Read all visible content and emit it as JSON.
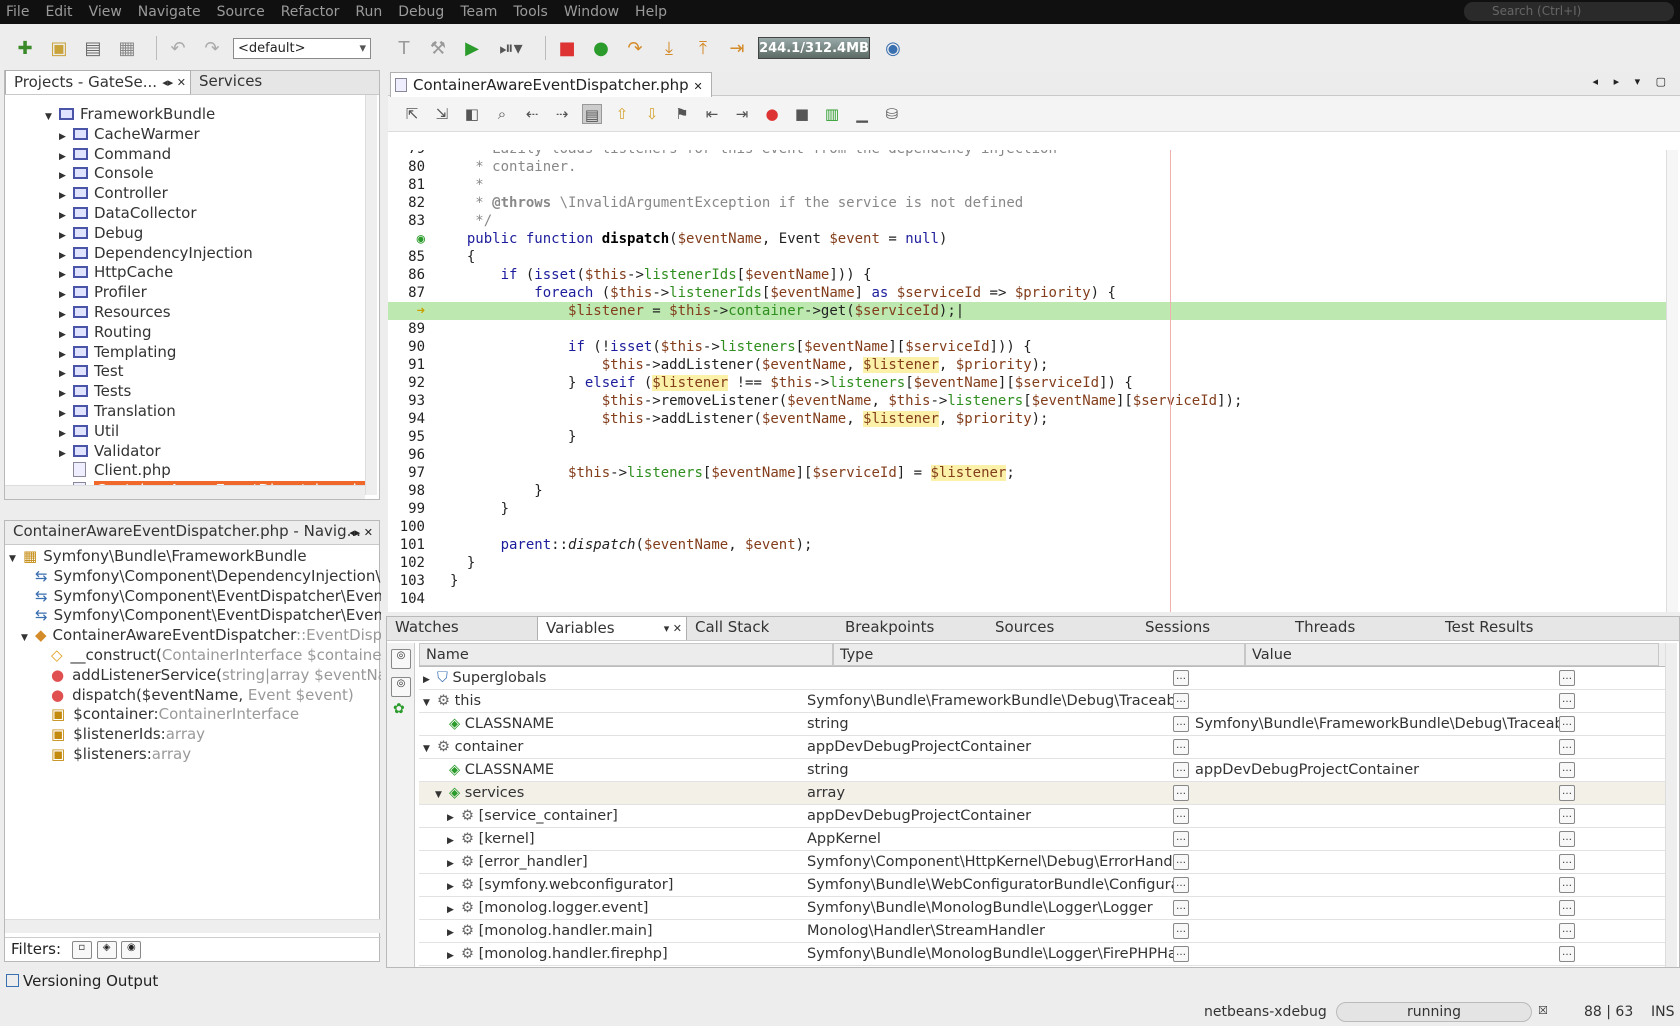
{
  "menu": [
    "File",
    "Edit",
    "View",
    "Navigate",
    "Source",
    "Refactor",
    "Run",
    "Debug",
    "Team",
    "Tools",
    "Window",
    "Help"
  ],
  "search_placeholder": "Search (Ctrl+I)",
  "toolbar": {
    "config": "<default>",
    "memory": "244.1/312.4MB"
  },
  "projects": {
    "tab1": "Projects - GateSe...",
    "tab2": "Services",
    "root": "FrameworkBundle",
    "items": [
      "CacheWarmer",
      "Command",
      "Console",
      "Controller",
      "DataCollector",
      "Debug",
      "DependencyInjection",
      "HttpCache",
      "Profiler",
      "Resources",
      "Routing",
      "Templating",
      "Test",
      "Tests",
      "Translation",
      "Util",
      "Validator"
    ],
    "files": [
      "Client.php",
      "ContainerAwareEventDispatcher.php"
    ]
  },
  "navigator": {
    "title": "ContainerAwareEventDispatcher.php - Navig...",
    "ns": "Symfony\\Bundle\\FrameworkBundle",
    "uses": [
      "Symfony\\Component\\DependencyInjection\\C",
      "Symfony\\Component\\EventDispatcher\\Event",
      "Symfony\\Component\\EventDispatcher\\Event"
    ],
    "cls": "ContainerAwareEventDispatcher",
    "cls_ext": "::EventDispa",
    "members": [
      {
        "n": "__construct(",
        "t": "ContainerInterface $container)"
      },
      {
        "n": "addListenerService(",
        "t": "string|array $eventName"
      },
      {
        "n": "dispatch($eventName, ",
        "t": "Event $event)"
      },
      {
        "n": "$container:",
        "t": "ContainerInterface"
      },
      {
        "n": "$listenerIds:",
        "t": "array"
      },
      {
        "n": "$listeners:",
        "t": "array"
      }
    ],
    "filters": "Filters:"
  },
  "editor": {
    "tab": "ContainerAwareEventDispatcher.php"
  },
  "debugger": {
    "tabs": [
      "Watches",
      "Variables",
      "Call Stack",
      "Breakpoints",
      "Sources",
      "Sessions",
      "Threads",
      "Test Results"
    ],
    "cols": [
      "Name",
      "Type",
      "Value"
    ],
    "rows": [
      {
        "name": "Superglobals",
        "type": "",
        "value": ""
      },
      {
        "name": "this",
        "type": "Symfony\\Bundle\\FrameworkBundle\\Debug\\Traceabl...",
        "value": ""
      },
      {
        "name": "CLASSNAME",
        "type": "string",
        "value": "Symfony\\Bundle\\FrameworkBundle\\Debug\\Traceabl..."
      },
      {
        "name": "container",
        "type": "appDevDebugProjectContainer",
        "value": ""
      },
      {
        "name": "CLASSNAME",
        "type": "string",
        "value": "appDevDebugProjectContainer"
      },
      {
        "name": "services",
        "type": "array",
        "value": ""
      },
      {
        "name": "[service_container]",
        "type": "appDevDebugProjectContainer",
        "value": ""
      },
      {
        "name": "[kernel]",
        "type": "AppKernel",
        "value": ""
      },
      {
        "name": "[error_handler]",
        "type": "Symfony\\Component\\HttpKernel\\Debug\\ErrorHandler",
        "value": ""
      },
      {
        "name": "[symfony.webconfigurator]",
        "type": "Symfony\\Bundle\\WebConfiguratorBundle\\Configurator",
        "value": ""
      },
      {
        "name": "[monolog.logger.event]",
        "type": "Symfony\\Bundle\\MonologBundle\\Logger\\Logger",
        "value": ""
      },
      {
        "name": "[monolog.handler.main]",
        "type": "Monolog\\Handler\\StreamHandler",
        "value": ""
      },
      {
        "name": "[monolog.handler.firephp]",
        "type": "Symfony\\Bundle\\MonologBundle\\Logger\\FirePHPHan...",
        "value": ""
      }
    ]
  },
  "versioning": "Versioning Output",
  "status": {
    "session": "netbeans-xdebug",
    "state": "running",
    "pos": "88 | 63",
    "mode": "INS"
  }
}
